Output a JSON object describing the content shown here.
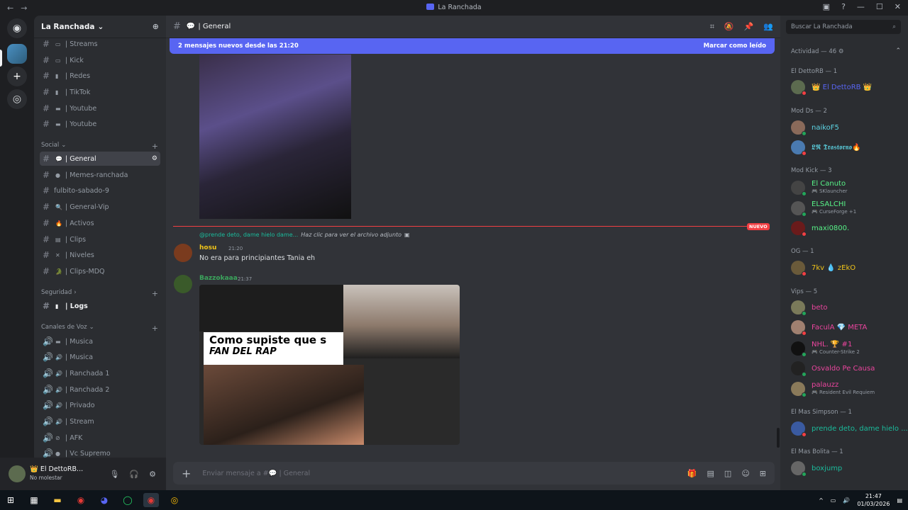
{
  "window": {
    "title": "La Ranchada",
    "back_label": "←",
    "forward_label": "→",
    "btn_minimize": "—",
    "btn_maximize": "☐",
    "btn_close": "✕"
  },
  "server": {
    "name": "La Ranchada"
  },
  "channels_top": [
    {
      "emoji": "▭",
      "label": "| Streams"
    },
    {
      "emoji": "▭",
      "label": "| Kick"
    },
    {
      "emoji": "▮",
      "label": "| Redes"
    },
    {
      "emoji": "▮",
      "label": "| TikTok"
    },
    {
      "emoji": "▬",
      "label": "| Youtube"
    },
    {
      "emoji": "▬",
      "label": "| Youtube"
    }
  ],
  "categories": {
    "social": "Social",
    "seguridad": "Seguridad",
    "voz": "Canales de Voz"
  },
  "channels_social": [
    {
      "emoji": "💬",
      "label": "| General"
    },
    {
      "emoji": "●",
      "label": "| Memes-ranchada"
    },
    {
      "emoji": "",
      "label": "fulbito-sabado-9"
    },
    {
      "emoji": "🔍",
      "label": "| General-Vip"
    },
    {
      "emoji": "🔥",
      "label": "| Activos"
    },
    {
      "emoji": "▤",
      "label": "| Clips"
    },
    {
      "emoji": "✕",
      "label": "| Niveles"
    },
    {
      "emoji": "🐊",
      "label": "| Clips-MDQ"
    }
  ],
  "channels_seguridad": [
    {
      "emoji": "▮",
      "label": "| Logs"
    }
  ],
  "channels_voz": [
    {
      "emoji": "▬",
      "label": "| Musica"
    },
    {
      "emoji": "🔊",
      "label": "| Musica"
    },
    {
      "emoji": "🔊",
      "label": "| Ranchada 1"
    },
    {
      "emoji": "🔊",
      "label": "| Ranchada 2"
    },
    {
      "emoji": "🔊",
      "label": "| Privado"
    },
    {
      "emoji": "🔊",
      "label": "| Stream"
    },
    {
      "emoji": "⊘",
      "label": "| AFK"
    },
    {
      "emoji": "●",
      "label": "| Vc Supremo"
    }
  ],
  "user_panel": {
    "name": "👑 El DettoRB...",
    "status": "No molestar"
  },
  "chat": {
    "channel_name": "| General",
    "banner_text": "2 mensajes nuevos desde las 21:20",
    "banner_action": "Marcar como leído",
    "new_tag": "NUEVO",
    "reply_preview": "@prende deto, dame hielo dame...",
    "reply_link": "Haz clic para ver el archivo adjunto",
    "messages": [
      {
        "author": "hosu",
        "badge": "⚡",
        "time": "21:20",
        "text": "No era para principiantes Tania eh",
        "color": "#f0c419"
      },
      {
        "author": "Bazzokaaa",
        "time": "21:37",
        "text": "",
        "color": "#3ba55c"
      }
    ],
    "meme_caption_1": "Como supiste que s",
    "meme_caption_2": "FAN DEL RAP",
    "composer_placeholder": "Enviar mensaje a #💬 | General"
  },
  "members": {
    "search_placeholder": "Buscar La Ranchada",
    "activity": "Actividad — 46",
    "groups": [
      {
        "title": "El DettoRB — 1",
        "items": [
          {
            "name": "👑 El DettoRB 👑",
            "color": "#5865f2",
            "sub": ""
          }
        ]
      },
      {
        "title": "Mod Ds — 2",
        "items": [
          {
            "name": "naikoF5",
            "color": "#5dd6e6",
            "sub": ""
          },
          {
            "name": "𝕷𝕽 𝕿𝖗𝖆𝖘𝖙𝖔𝖗𝖓𝖔🔥",
            "color": "#5dd6e6",
            "sub": ""
          }
        ]
      },
      {
        "title": "Mod Kick — 3",
        "items": [
          {
            "name": "El Canuto",
            "color": "#57f287",
            "sub": "🎮 SKlauncher"
          },
          {
            "name": "ELSALCHI",
            "color": "#57f287",
            "sub": "🎮 CurseForge +1"
          },
          {
            "name": "maxi0800.",
            "color": "#57f287",
            "sub": ""
          }
        ]
      },
      {
        "title": "OG — 1",
        "items": [
          {
            "name": "7kv 💧 zEkO",
            "color": "#f0c419",
            "sub": ""
          }
        ]
      },
      {
        "title": "Vips — 5",
        "items": [
          {
            "name": "beto",
            "color": "#eb459e",
            "sub": ""
          },
          {
            "name": "FaculA 💎 META",
            "color": "#eb459e",
            "sub": ""
          },
          {
            "name": "NHL. 🏆 #1",
            "color": "#eb459e",
            "sub": "🎮 Counter-Strike 2"
          },
          {
            "name": "Osvaldo Pe Causa",
            "color": "#eb459e",
            "sub": ""
          },
          {
            "name": "palauzz",
            "color": "#eb459e",
            "sub": "🎮 Resident Evil Requiem"
          }
        ]
      },
      {
        "title": "El Mas Simpson — 1",
        "items": [
          {
            "name": "prende deto, dame hielo ...",
            "color": "#1abc9c",
            "sub": ""
          }
        ]
      },
      {
        "title": "El Mas Bolita — 1",
        "items": [
          {
            "name": "boxjump",
            "color": "#1abc9c",
            "sub": ""
          }
        ]
      }
    ]
  },
  "taskbar": {
    "time": "21:47",
    "date": "01/03/2026"
  }
}
